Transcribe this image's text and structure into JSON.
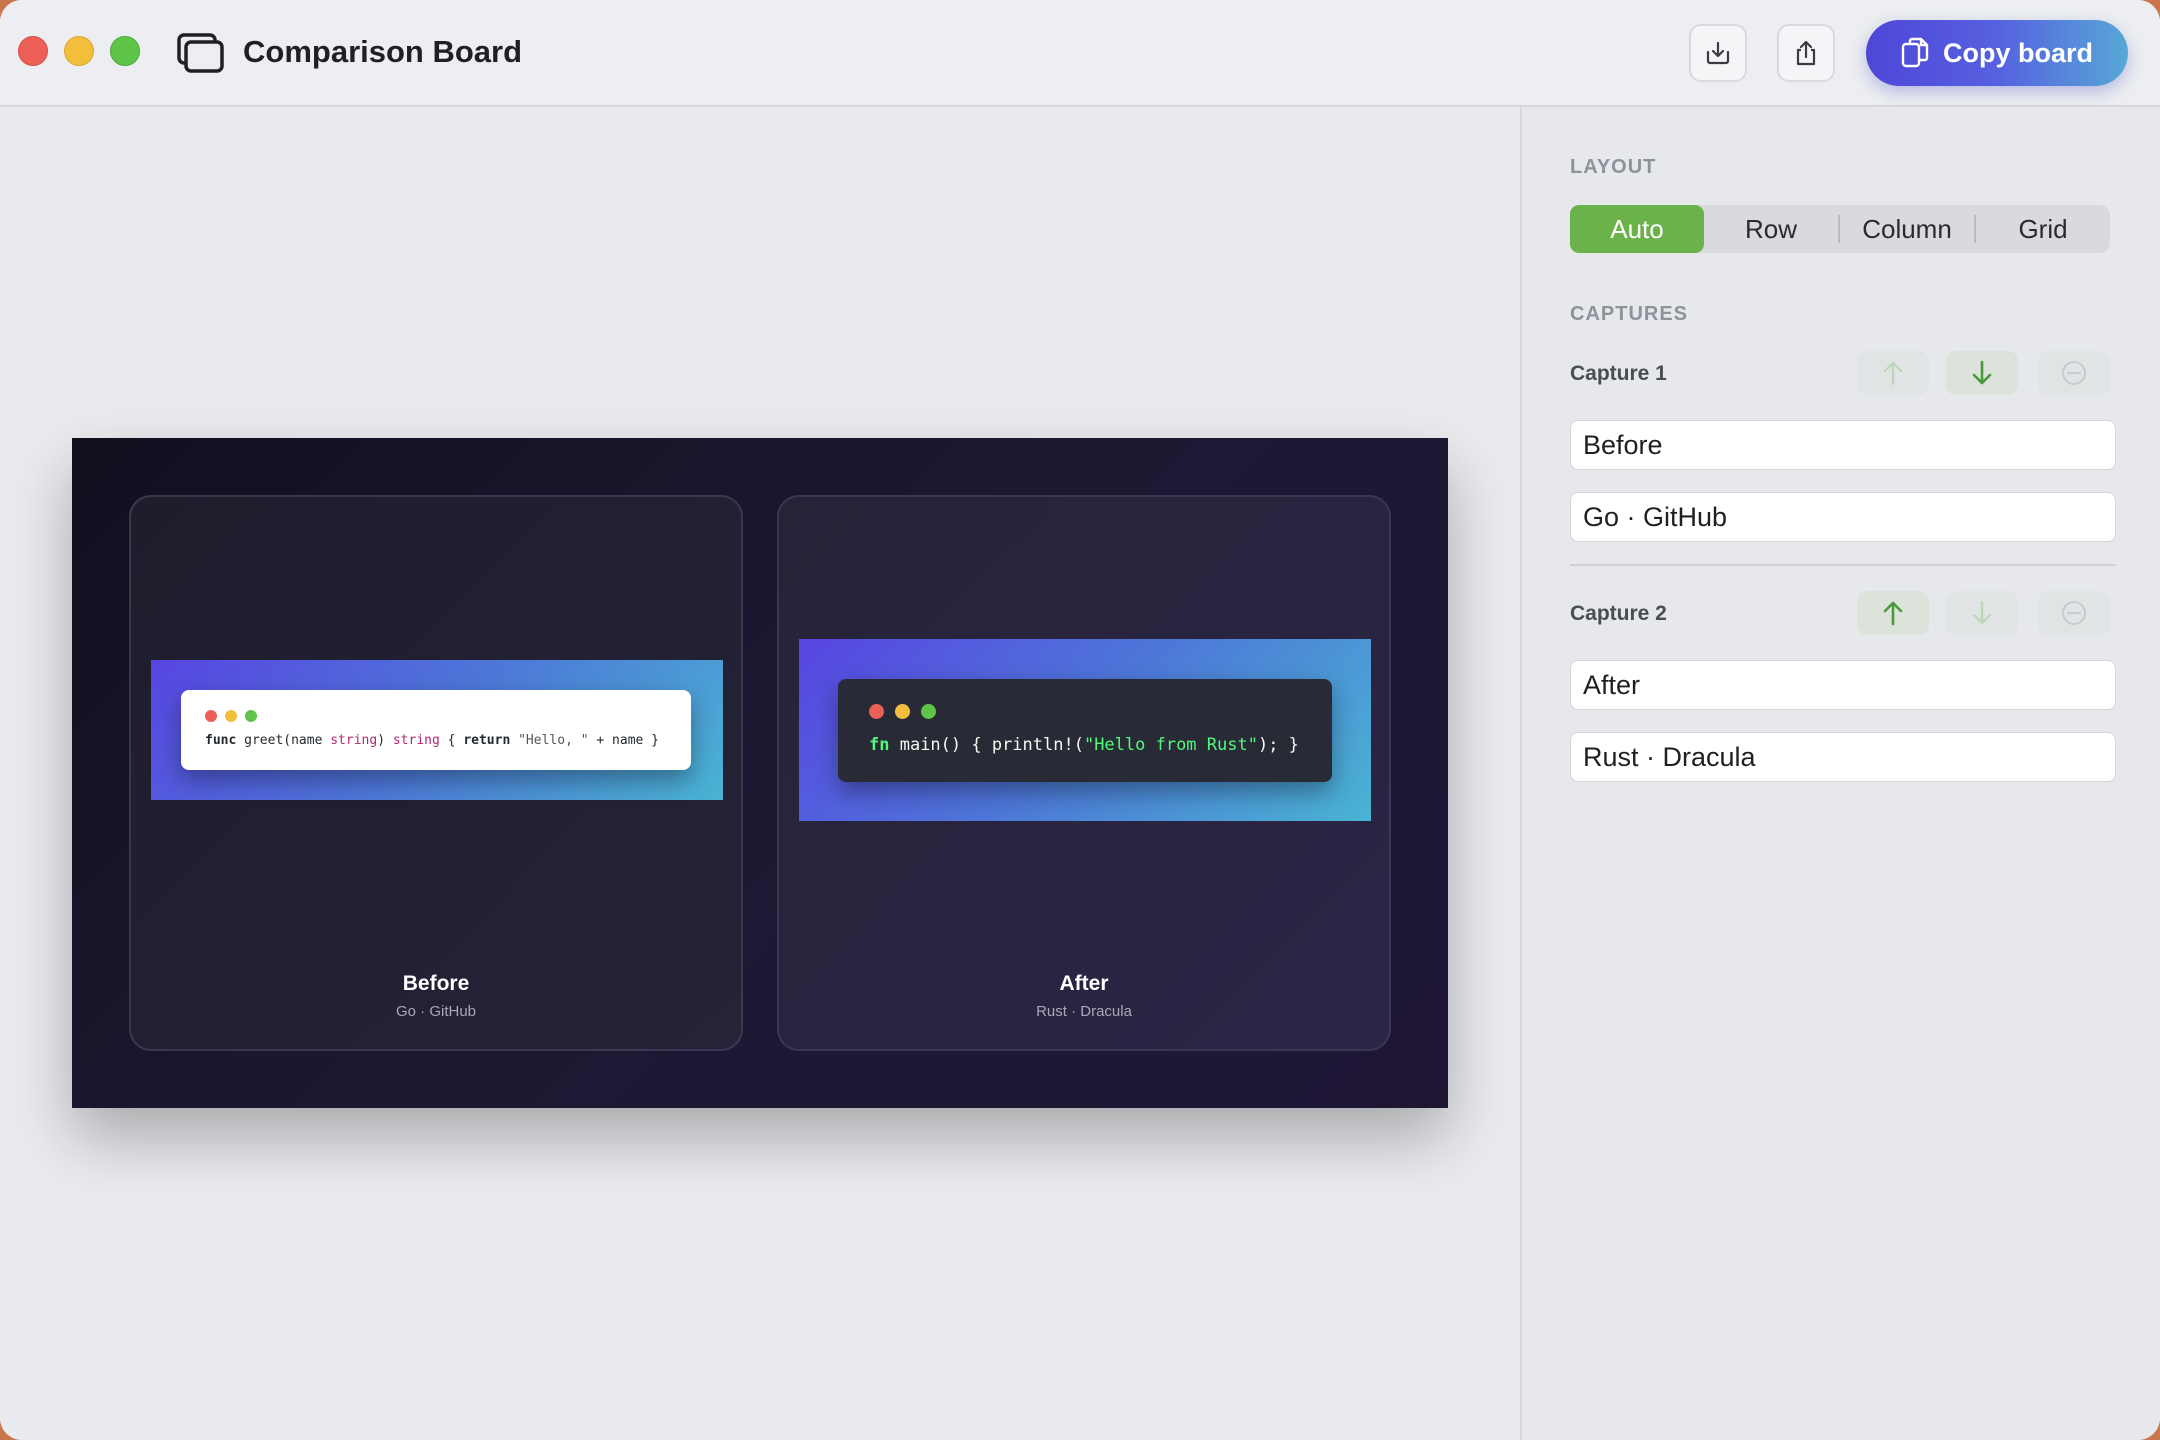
{
  "window": {
    "title": "Comparison Board"
  },
  "toolbar": {
    "download_icon": "tray-arrow-down-icon",
    "share_icon": "square-arrow-up-icon",
    "copy_label": "Copy board",
    "copy_icon": "documents-icon",
    "accent": "#4f46d8"
  },
  "board": {
    "cards": [
      {
        "title": "Before",
        "subtitle": "Go · GitHub",
        "code": {
          "kw1": "func",
          "p1": " greet(name ",
          "ty1": "string",
          "p2": ") ",
          "ty2": "string",
          "p3": " { ",
          "kw2": "return",
          "str": " \"Hello, \"",
          "p4": " + name }"
        }
      },
      {
        "title": "After",
        "subtitle": "Rust · Dracula",
        "code": {
          "kw1": "fn",
          "p1": " main() { println!(",
          "str": "\"Hello from Rust\"",
          "p2": "); }"
        }
      }
    ]
  },
  "sidebar": {
    "layout_label": "LAYOUT",
    "layout_options": [
      "Auto",
      "Row",
      "Column",
      "Grid"
    ],
    "layout_selected": "Auto",
    "layout_accent": "#6bb24a",
    "captures_label": "CAPTURES",
    "captures": [
      {
        "label": "Capture 1",
        "title": "Before",
        "subtitle": "Go · GitHub",
        "move_up_enabled": false,
        "move_down_enabled": true,
        "remove_enabled": false
      },
      {
        "label": "Capture 2",
        "title": "After",
        "subtitle": "Rust · Dracula",
        "move_up_enabled": true,
        "move_down_enabled": false,
        "remove_enabled": false
      }
    ]
  }
}
